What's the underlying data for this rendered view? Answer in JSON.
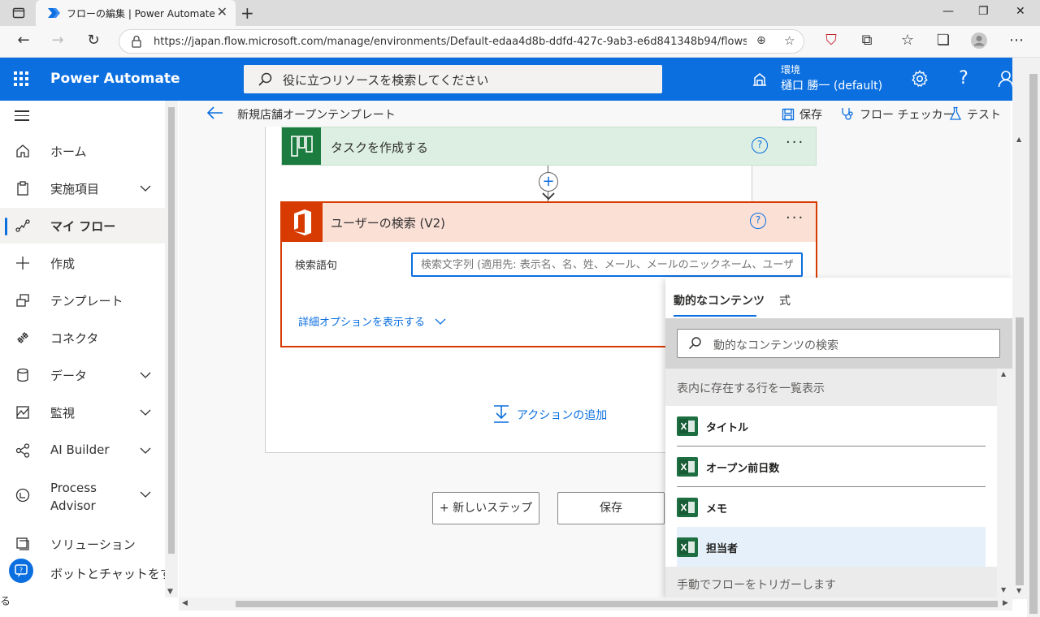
{
  "browser": {
    "tab_title": "フローの編集 | Power Automate",
    "url": "https://japan.flow.microsoft.com/manage/environments/Default-edaa4d8b-ddfd-427c-9ab3-e6d841348b94/flows/ff..."
  },
  "header": {
    "app_name": "Power Automate",
    "search_placeholder": "役に立つリソースを検索してください",
    "env_label": "環境",
    "env_name": "樋口 勝一 (default)"
  },
  "sidebar": {
    "items": [
      {
        "label": "ホーム"
      },
      {
        "label": "実施項目"
      },
      {
        "label": "マイ フロー"
      },
      {
        "label": "作成"
      },
      {
        "label": "テンプレート"
      },
      {
        "label": "コネクタ"
      },
      {
        "label": "データ"
      },
      {
        "label": "監視"
      },
      {
        "label": "AI Builder"
      },
      {
        "label": "Process Advisor"
      },
      {
        "label": "ソリューション"
      }
    ],
    "chat_label": "ボットとチャットをする",
    "chat_wrap": "る"
  },
  "cmdbar": {
    "flow_name": "新規店舗オープンテンプレート",
    "save": "保存",
    "checker": "フロー チェッカー",
    "test": "テスト"
  },
  "flow": {
    "step1_title": "タスクを作成する",
    "step2_title": "ユーザーの検索 (V2)",
    "field_label": "検索語句",
    "field_placeholder": "検索文字列 (適用先: 表示名、名、姓、メール、メールのニックネーム、ユーザー プリンシパル名)",
    "advanced_link": "詳細オプションを表示する",
    "add_action": "アクションの追加",
    "new_step": "+ 新しいステップ",
    "save_button": "保存",
    "help_glyph": "?"
  },
  "dynamic": {
    "tab_dynamic": "動的なコンテンツ",
    "tab_expression": "式",
    "search_placeholder": "動的なコンテンツの検索",
    "section1": "表内に存在する行を一覧表示",
    "items": [
      {
        "label": "タイトル"
      },
      {
        "label": "オープン前日数"
      },
      {
        "label": "メモ"
      },
      {
        "label": "担当者"
      }
    ],
    "section2": "手動でフローをトリガーします"
  },
  "colors": {
    "brand_blue": "#0b6fe0",
    "planner_green": "#1c7c3f",
    "office_red": "#d83b01",
    "excel_green": "#1d6f42"
  }
}
